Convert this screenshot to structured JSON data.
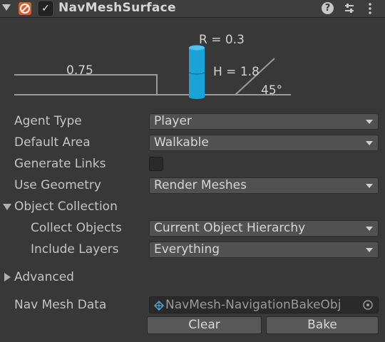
{
  "header": {
    "title": "NavMeshSurface",
    "enabled_mark": "✓",
    "help_glyph": "?"
  },
  "diagram": {
    "radius_label": "R = 0.3",
    "height_label": "H = 1.8",
    "step_label": "0.75",
    "slope_label": "45°",
    "agent_color": "#1aa3d6"
  },
  "fields": {
    "agent_type": {
      "label": "Agent Type",
      "value": "Player"
    },
    "default_area": {
      "label": "Default Area",
      "value": "Walkable"
    },
    "generate_links": {
      "label": "Generate Links",
      "checked": false
    },
    "use_geometry": {
      "label": "Use Geometry",
      "value": "Render Meshes"
    }
  },
  "object_collection": {
    "label": "Object Collection",
    "expanded": true,
    "collect_objects": {
      "label": "Collect Objects",
      "value": "Current Object Hierarchy"
    },
    "include_layers": {
      "label": "Include Layers",
      "value": "Everything"
    }
  },
  "advanced": {
    "label": "Advanced",
    "expanded": false
  },
  "nav_mesh_data": {
    "label": "Nav Mesh Data",
    "value": "NavMesh-NavigationBakeObj"
  },
  "buttons": {
    "clear": "Clear",
    "bake": "Bake"
  }
}
